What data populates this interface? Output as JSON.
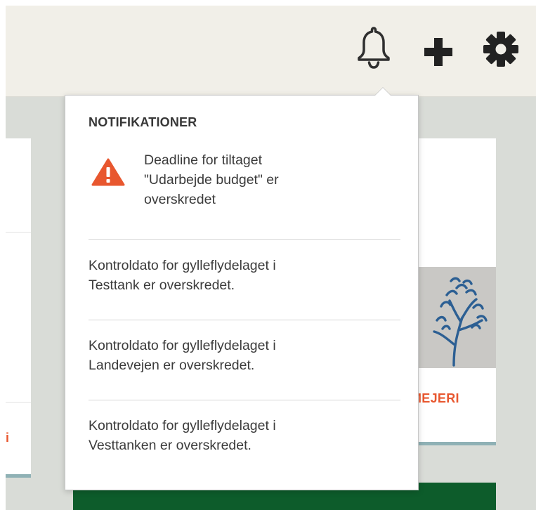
{
  "topbar": {
    "icons": [
      "bell-icon",
      "plus-icon",
      "gear-icon"
    ]
  },
  "right_card": {
    "brand_text": "MEJERI"
  },
  "left_card": {
    "edge_mark": "i"
  },
  "notifications": {
    "title": "NOTIFIKATIONER",
    "items": [
      {
        "icon": "warning-icon",
        "lines": [
          "Deadline for tiltaget",
          "\"Udarbejde budget\" er",
          "overskredet"
        ]
      },
      {
        "lines": [
          "Kontroldato for gylleflydelaget i",
          "Testtank er overskredet."
        ]
      },
      {
        "lines": [
          "Kontroldato for gylleflydelaget i",
          "Landevejen er overskredet."
        ]
      },
      {
        "lines": [
          "Kontroldato for gylleflydelaget i",
          "Vesttanken er overskredet."
        ]
      }
    ]
  },
  "colors": {
    "topbar_bg": "#f1efe8",
    "page_bg": "#d9dcd7",
    "accent_orange": "#e8572f",
    "dark_green": "#0d5c2b",
    "card_border": "#8fb1b5"
  }
}
